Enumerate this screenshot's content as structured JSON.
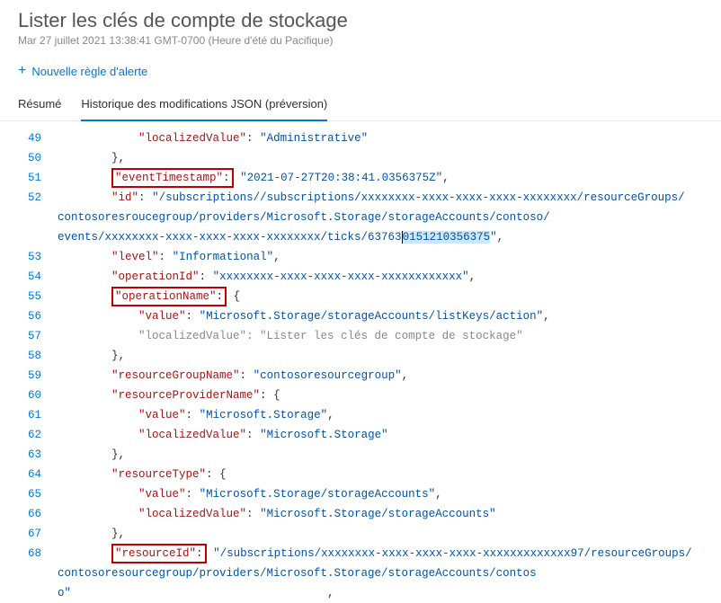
{
  "header": {
    "title": "Lister les clés de compte de stockage",
    "subtitle": "Mar 27 juillet 2021 13:38:41 GMT-0700 (Heure d'été du Pacifique)"
  },
  "toolbar": {
    "new_alert_label": "Nouvelle règle d'alerte"
  },
  "tabs": {
    "summary": "Résumé",
    "json_history": "Historique des modifications JSON (préversion)"
  },
  "code": {
    "lines": {
      "49": {
        "indent": 3,
        "key": "localizedValue",
        "val": "Administrative"
      },
      "50": {
        "indent": 2,
        "raw_close": "},"
      },
      "51": {
        "indent": 2,
        "key_boxed": "eventTimestamp",
        "val": "2021-07-27T20:38:41.0356375Z",
        "comma": true
      },
      "52": {
        "indent": 2,
        "key": "id",
        "val_parts": [
          "/subscriptions//subscriptions/xxxxxxxx-xxxx-xxxx-xxxx-xxxxxxxx/resourceGroups/",
          "contosoresroucegroup/providers/Microsoft.Storage/storageAccounts/contoso/",
          "events/xxxxxxxx-xxxx-xxxx-xxxx-xxxxxxxx/ticks/63763"
        ],
        "val_selected": "0151210356375",
        "val_tail": "\"",
        "comma": true
      },
      "53": {
        "indent": 2,
        "key": "level",
        "val": "Informational",
        "comma": true
      },
      "54": {
        "indent": 2,
        "key": "operationId",
        "val": "xxxxxxxx-xxxx-xxxx-xxxx-xxxxxxxxxxxx",
        "comma": true
      },
      "55": {
        "indent": 2,
        "key_boxed": "operationName",
        "open_obj": true
      },
      "56": {
        "indent": 3,
        "key": "value",
        "val": "Microsoft.Storage/storageAccounts/listKeys/action",
        "comma": true
      },
      "57": {
        "indent": 3,
        "gray_key": "localizedValue",
        "gray_val": "Lister les clés de compte de stockage"
      },
      "58": {
        "indent": 2,
        "raw_close": "},"
      },
      "59": {
        "indent": 2,
        "key": "resourceGroupName",
        "val": "contosoresourcegroup",
        "comma": true
      },
      "60": {
        "indent": 2,
        "key": "resourceProviderName",
        "open_obj": true
      },
      "61": {
        "indent": 3,
        "key": "value",
        "val": "Microsoft.Storage",
        "comma": true
      },
      "62": {
        "indent": 3,
        "key": "localizedValue",
        "val": "Microsoft.Storage"
      },
      "63": {
        "indent": 2,
        "raw_close": "},"
      },
      "64": {
        "indent": 2,
        "key": "resourceType",
        "open_obj": true
      },
      "65": {
        "indent": 3,
        "key": "value",
        "val": "Microsoft.Storage/storageAccounts",
        "comma": true
      },
      "66": {
        "indent": 3,
        "key": "localizedValue",
        "val": "Microsoft.Storage/storageAccounts"
      },
      "67": {
        "indent": 2,
        "raw_close": "},"
      },
      "68": {
        "indent": 2,
        "key_boxed": "resourceId",
        "val_parts": [
          "/subscriptions/xxxxxxxx-xxxx-xxxx-xxxx-xxxxxxxxxxxxx97/resourceGroups/",
          "contosoresourcegroup/providers/Microsoft.Storage/storageAccounts/contoso"
        ],
        "comma_wide": true
      }
    }
  }
}
